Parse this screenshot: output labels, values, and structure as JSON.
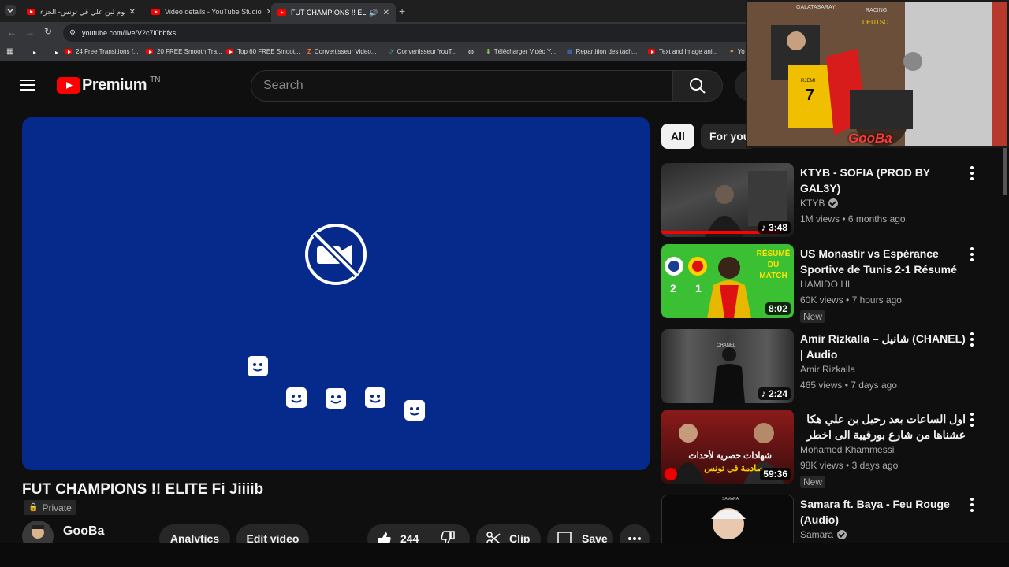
{
  "browser": {
    "tabs": [
      {
        "title": "اخر يوم لبن علي في تونس- الجزء"
      },
      {
        "title": "Video details - YouTube Studio"
      },
      {
        "title": "FUT CHAMPIONS !! ELITE Fi Jiiiib"
      }
    ],
    "url": "youtube.com/live/V2c7i0bbfxs",
    "bookmarks": [
      "24 Free Transitions f...",
      "20 FREE Smooth Tra...",
      "Top 60 FREE Smoot...",
      "Convertisseur Video...",
      "Convertisseur YouT...",
      "Télécharger Vidéo Y...",
      "Repartition des tach...",
      "Text and Image ani...",
      "Yo"
    ]
  },
  "masthead": {
    "logo_text": "Premium",
    "country_code": "TN",
    "search_placeholder": "Search"
  },
  "video": {
    "title": "FUT CHAMPIONS !! ELITE Fi Jiiiib",
    "privacy": "Private",
    "channel": "GooBa",
    "actions": {
      "analytics": "Analytics",
      "edit": "Edit video",
      "likes": "244",
      "clip": "Clip",
      "save": "Save"
    }
  },
  "chips": [
    "All",
    "For you"
  ],
  "recommendations": [
    {
      "title": "KTYB - SOFIA (PROD BY GAL3Y)",
      "channel": "KTYB",
      "verified": true,
      "views": "1M views",
      "age": "6 months ago",
      "duration": "3:48",
      "music": true,
      "badge": ""
    },
    {
      "title": "US Monastir vs Espérance Sportive de Tunis 2-1 Résumé ...",
      "channel": "HAMIDO HL",
      "verified": false,
      "views": "60K views",
      "age": "7 hours ago",
      "duration": "8:02",
      "music": false,
      "badge": "New"
    },
    {
      "title": "Amir Rizkalla – شانيل (CHANEL) | Audio",
      "channel": "Amir Rizkalla",
      "verified": false,
      "views": "465 views",
      "age": "7 days ago",
      "duration": "2:24",
      "music": true,
      "badge": ""
    },
    {
      "title": "اول الساعات بعد رحيل بن علي هكا عشناها من شارع بورقيبة الى اخطر سجون تونس: ...",
      "channel": "Mohamed Khammessi",
      "verified": false,
      "views": "98K views",
      "age": "3 days ago",
      "duration": "59:36",
      "music": false,
      "badge": "New"
    },
    {
      "title": "Samara ft. Baya - Feu Rouge (Audio)",
      "channel": "Samara",
      "verified": true,
      "views": "",
      "age": "",
      "duration": "",
      "music": false,
      "badge": ""
    }
  ],
  "thumb_text": {
    "resume": "RÉSUMÉ DU MATCH",
    "score_home": "2",
    "score_away": "1",
    "chanel": "CHANEL",
    "arabic_line1": "شهادات حصرية لأحداث",
    "arabic_line2": "صادمة في تونس",
    "samara": "SAMARA"
  },
  "webcam": {
    "overlay_name": "GooBa",
    "jersey_name": "RJEMI",
    "jersey_number": "7",
    "label_top": "GALATASARAY",
    "label_side": "DEUTSC",
    "label_chair": "RACING"
  },
  "colors": {
    "youtube_red": "#ff0000",
    "player_bg": "#052a8c",
    "page_bg": "#0f0f0f"
  }
}
